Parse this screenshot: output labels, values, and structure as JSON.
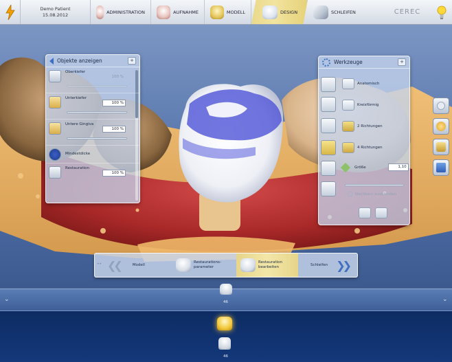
{
  "patient": {
    "name": "Demo Patient",
    "date": "15.08.2012"
  },
  "steps": [
    {
      "label": "ADMINISTRATION",
      "icon": "admin-dentures-icon"
    },
    {
      "label": "AUFNAHME",
      "icon": "acquisition-teeth-icon"
    },
    {
      "label": "MODELL",
      "icon": "model-icon"
    },
    {
      "label": "DESIGN",
      "icon": "design-tooth-icon",
      "active": true
    },
    {
      "label": "SCHLEIFEN",
      "icon": "milling-icon"
    }
  ],
  "brand": "CEREC",
  "objects_panel": {
    "title": "Objekte anzeigen",
    "items": [
      {
        "label": "Oberkiefer",
        "value": "100 %",
        "dim": true
      },
      {
        "label": "Unterkiefer",
        "value": "100 %"
      },
      {
        "label": "Untere Gingiva",
        "value": "100 %"
      },
      {
        "label": "Mindestdicke"
      },
      {
        "label": "Restauration",
        "value": "100 %"
      }
    ]
  },
  "tools_panel": {
    "title": "Werkzeuge",
    "items": [
      {
        "label": "Anatomisch"
      },
      {
        "label": "Kreisförmig"
      },
      {
        "label": "2 Richtungen"
      },
      {
        "label": "4 Richtungen"
      }
    ],
    "size_label": "Größe",
    "size_value": "1,10",
    "hide_label": "Nachbarn ausblenden"
  },
  "workflow": {
    "items": [
      {
        "label": "Modell"
      },
      {
        "label": "Restaurations-\nparameter"
      },
      {
        "label": "Restauration\nbearbeiten",
        "active": true
      },
      {
        "label": "Schleifen"
      }
    ]
  },
  "teeth": {
    "upper": "46",
    "lower": "46"
  }
}
